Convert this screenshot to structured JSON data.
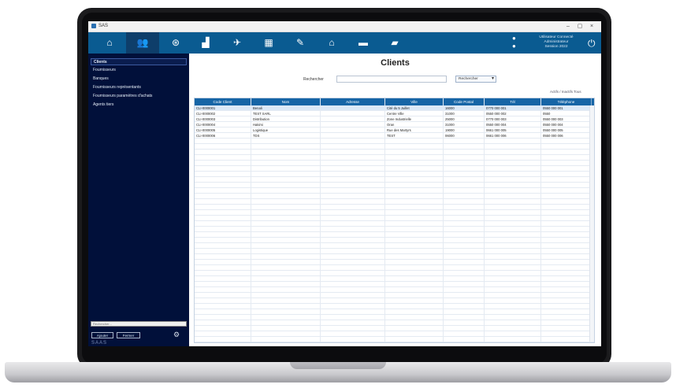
{
  "window": {
    "title": "SAS",
    "buttons": [
      "–",
      "▢",
      "×"
    ]
  },
  "toolbar": {
    "items": [
      {
        "icon": "home-icon",
        "glyph": "⌂"
      },
      {
        "icon": "users-icon",
        "glyph": "👥"
      },
      {
        "icon": "gear-icon",
        "glyph": "⊛"
      },
      {
        "icon": "chart-icon",
        "glyph": "▟"
      },
      {
        "icon": "rocket-icon",
        "glyph": "✈"
      },
      {
        "icon": "calendar-icon",
        "glyph": "▦"
      },
      {
        "icon": "pen-icon",
        "glyph": "✎"
      },
      {
        "icon": "bank-icon",
        "glyph": "⌂"
      },
      {
        "icon": "card-icon",
        "glyph": "▬"
      },
      {
        "icon": "folder-icon",
        "glyph": "▰"
      }
    ],
    "user": {
      "line1": "Utilisateur Connecté",
      "line2": "Administrateur",
      "line3": "Session 2022"
    }
  },
  "sidebar": {
    "items": [
      {
        "label": "Clients",
        "active": true
      },
      {
        "label": "Fournisseurs",
        "active": false
      },
      {
        "label": "Banques",
        "active": false
      },
      {
        "label": "Fournisseurs représentants",
        "active": false
      },
      {
        "label": "Fournisseurs paramètres d'achats",
        "active": false
      },
      {
        "label": "Agents tiers",
        "active": false
      }
    ],
    "bottom_input": "Rechercher...",
    "btn_left": "Ajouter",
    "btn_mid": "Fermer",
    "logo": "SAAS"
  },
  "main": {
    "title": "Clients",
    "search_label": "Rechercher",
    "search_value": "",
    "filter_value": "Rechercher",
    "link_right": "Actifs / Inactifs Tous"
  },
  "table": {
    "columns": [
      "Code Client",
      "Nom",
      "Adresse",
      "Ville",
      "Code Postal",
      "Tél",
      "Téléphone"
    ],
    "rows": [
      [
        "CLI-0000001",
        "Benali",
        "",
        "Cité du 5 Juillet",
        "16000",
        "0770 000 001",
        "0550 000 001"
      ],
      [
        "CLI-0000002",
        "TEST SARL",
        "",
        "Centre Ville",
        "31000",
        "0550 000 002",
        "0550"
      ],
      [
        "CLI-0000003",
        "Distribution",
        "",
        "Zone Industrielle",
        "25000",
        "0770 000 003",
        "0550 000 003"
      ],
      [
        "CLI-0000004",
        "Hakimi",
        "",
        "Oran",
        "31000",
        "0550 000 004",
        "0550 000 004"
      ],
      [
        "CLI-0000005",
        "Logistique",
        "",
        "Rue des Martyrs",
        "19000",
        "0661 000 005",
        "0550 000 005"
      ],
      [
        "CLI-0000006",
        "TDS",
        "",
        "TEST",
        "06000",
        "0661 000 006",
        "0550 000 006"
      ]
    ]
  }
}
